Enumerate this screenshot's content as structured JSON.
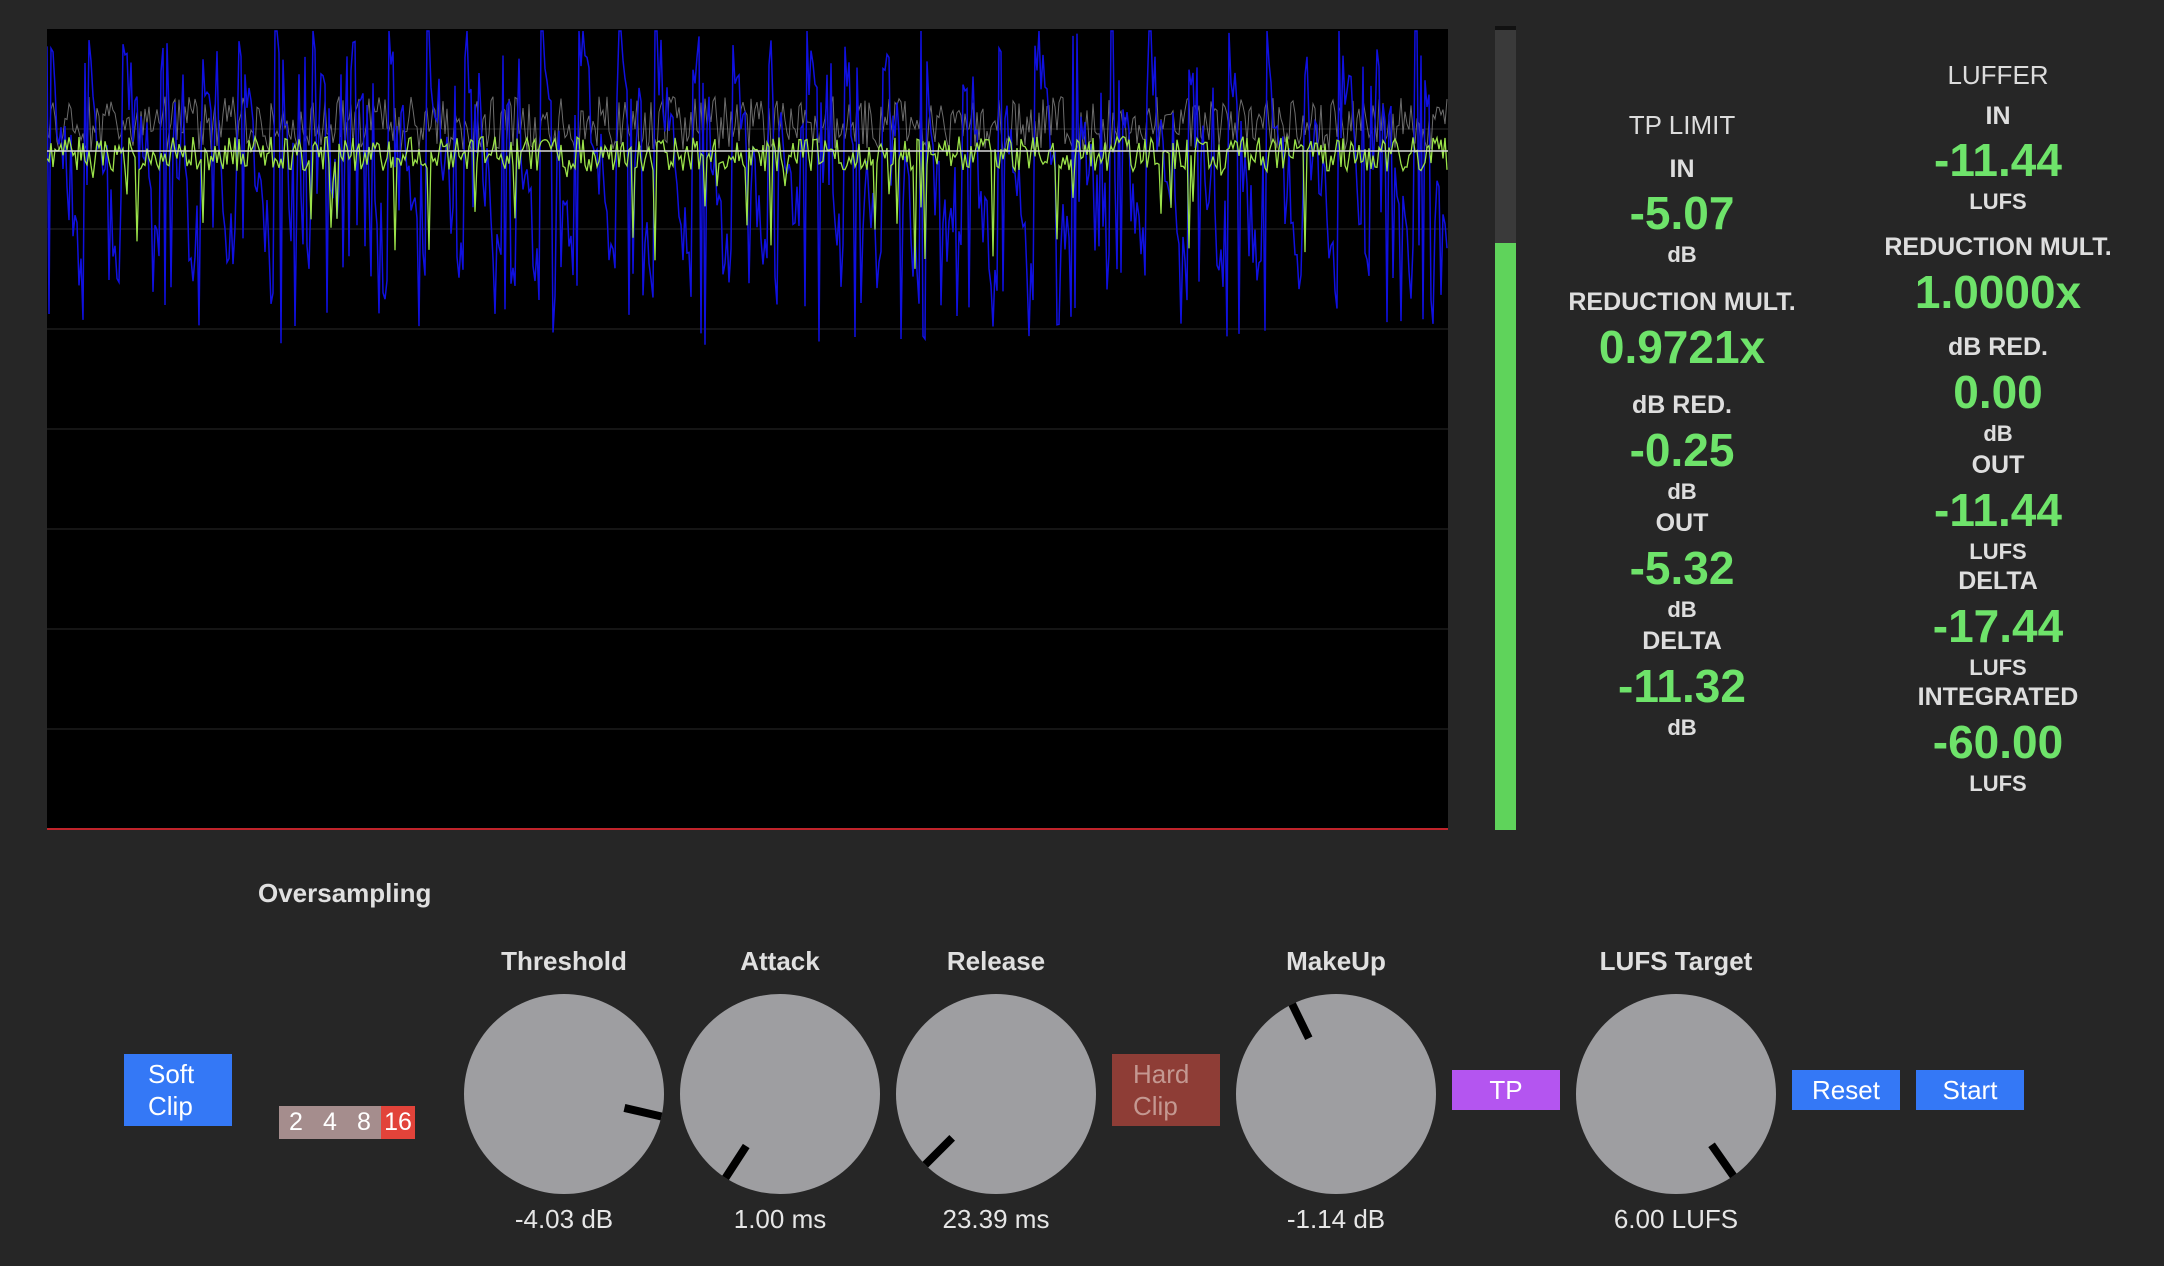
{
  "scope": {
    "colors": {
      "background": "#000000",
      "grid": "#2a2a2a",
      "blue_trace": "#1010e0",
      "green_trace": "#9be24a",
      "gray_trace": "#9a9a9a",
      "threshold_line": "#d8d8d8",
      "bottom_line": "#c0242b"
    }
  },
  "meter": {
    "level": 0.73,
    "color": "#5fd35b"
  },
  "tp": {
    "header": "TP LIMIT",
    "in_label": "IN",
    "in_value": "-5.07",
    "in_unit": "dB",
    "red_mult_label": "REDUCTION MULT.",
    "red_mult_value": "0.9721x",
    "db_red_label": "dB RED.",
    "db_red_value": "-0.25",
    "db_red_unit": "dB",
    "out_label": "OUT",
    "out_value": "-5.32",
    "out_unit": "dB",
    "delta_label": "DELTA",
    "delta_value": "-11.32",
    "delta_unit": "dB"
  },
  "luffer": {
    "header": "LUFFER",
    "in_label": "IN",
    "in_value": "-11.44",
    "in_unit": "LUFS",
    "red_mult_label": "REDUCTION MULT.",
    "red_mult_value": "1.0000x",
    "db_red_label": "dB RED.",
    "db_red_value": "0.00",
    "db_red_unit": "dB",
    "out_label": "OUT",
    "out_value": "-11.44",
    "out_unit": "LUFS",
    "delta_label": "DELTA",
    "delta_value": "-17.44",
    "delta_unit": "LUFS",
    "integrated_label": "INTEGRATED",
    "integrated_value": "-60.00",
    "integrated_unit": "LUFS"
  },
  "controls": {
    "oversampling_label": "Oversampling",
    "oversampling_options": [
      "2",
      "4",
      "8",
      "16"
    ],
    "oversampling_selected": "16",
    "soft_clip_label": "Soft Clip",
    "hard_clip_label": "Hard Clip",
    "tp_label": "TP",
    "reset_label": "Reset",
    "start_label": "Start",
    "knobs": {
      "threshold": {
        "title": "Threshold",
        "value": "-4.03 dB",
        "angle": 103
      },
      "attack": {
        "title": "Attack",
        "value": "1.00 ms",
        "angle": 213
      },
      "release": {
        "title": "Release",
        "value": "23.39 ms",
        "angle": 225
      },
      "makeup": {
        "title": "MakeUp",
        "value": "-1.14 dB",
        "angle": 334
      },
      "lufs": {
        "title": "LUFS Target",
        "value": "6.00 LUFS",
        "angle": 145
      }
    },
    "colors": {
      "button_blue": "#3478f6",
      "hard_clip": "#8e3d36",
      "hard_clip_text": "#c49891",
      "tp_button": "#b455f0",
      "knob": "#9e9ea1",
      "indicator": "#000000"
    }
  }
}
